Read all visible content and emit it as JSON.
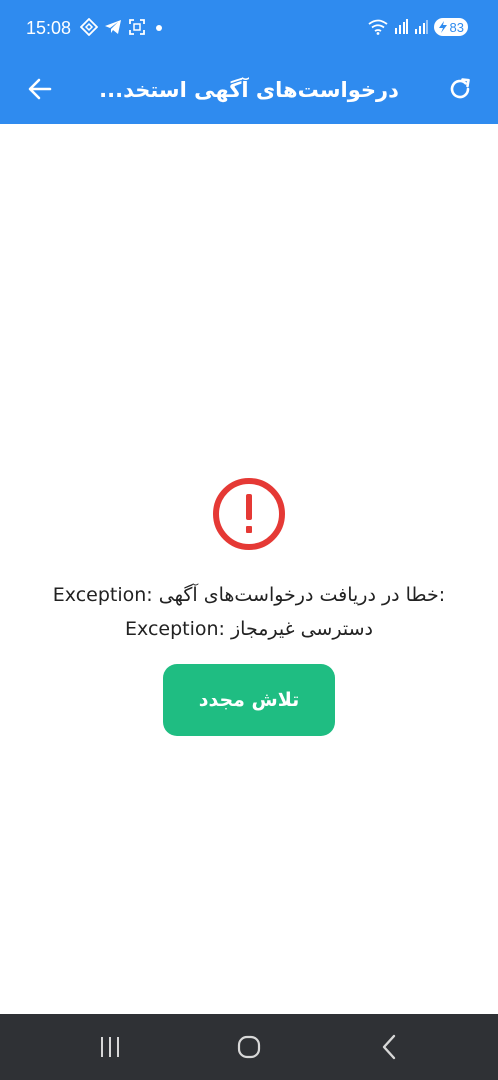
{
  "status_bar": {
    "time": "15:08",
    "battery_level": "83",
    "icons_left": [
      "vpn-key-icon",
      "telegram-icon",
      "screenshot-icon",
      "notification-dot-icon"
    ],
    "icons_right": [
      "wifi-icon",
      "volte-signal-icon",
      "cellular-signal-icon",
      "battery-charging-icon"
    ]
  },
  "app_bar": {
    "title": "درخواست‌های آگهی استخد...",
    "back_icon": "arrow-back-icon",
    "refresh_icon": "refresh-icon",
    "background_color": "#2f8bef"
  },
  "error": {
    "icon": "error-circle-icon",
    "icon_color": "#e53935",
    "line1": "Exception: خطا در دریافت درخواست‌های آگهی:",
    "line2": "Exception: دسترسی غیرمجاز"
  },
  "retry_button": {
    "label": "تلاش مجدد",
    "color": "#1fbd82"
  },
  "nav_bar": {
    "icons": [
      "recent-apps-icon",
      "home-icon",
      "back-icon"
    ]
  }
}
